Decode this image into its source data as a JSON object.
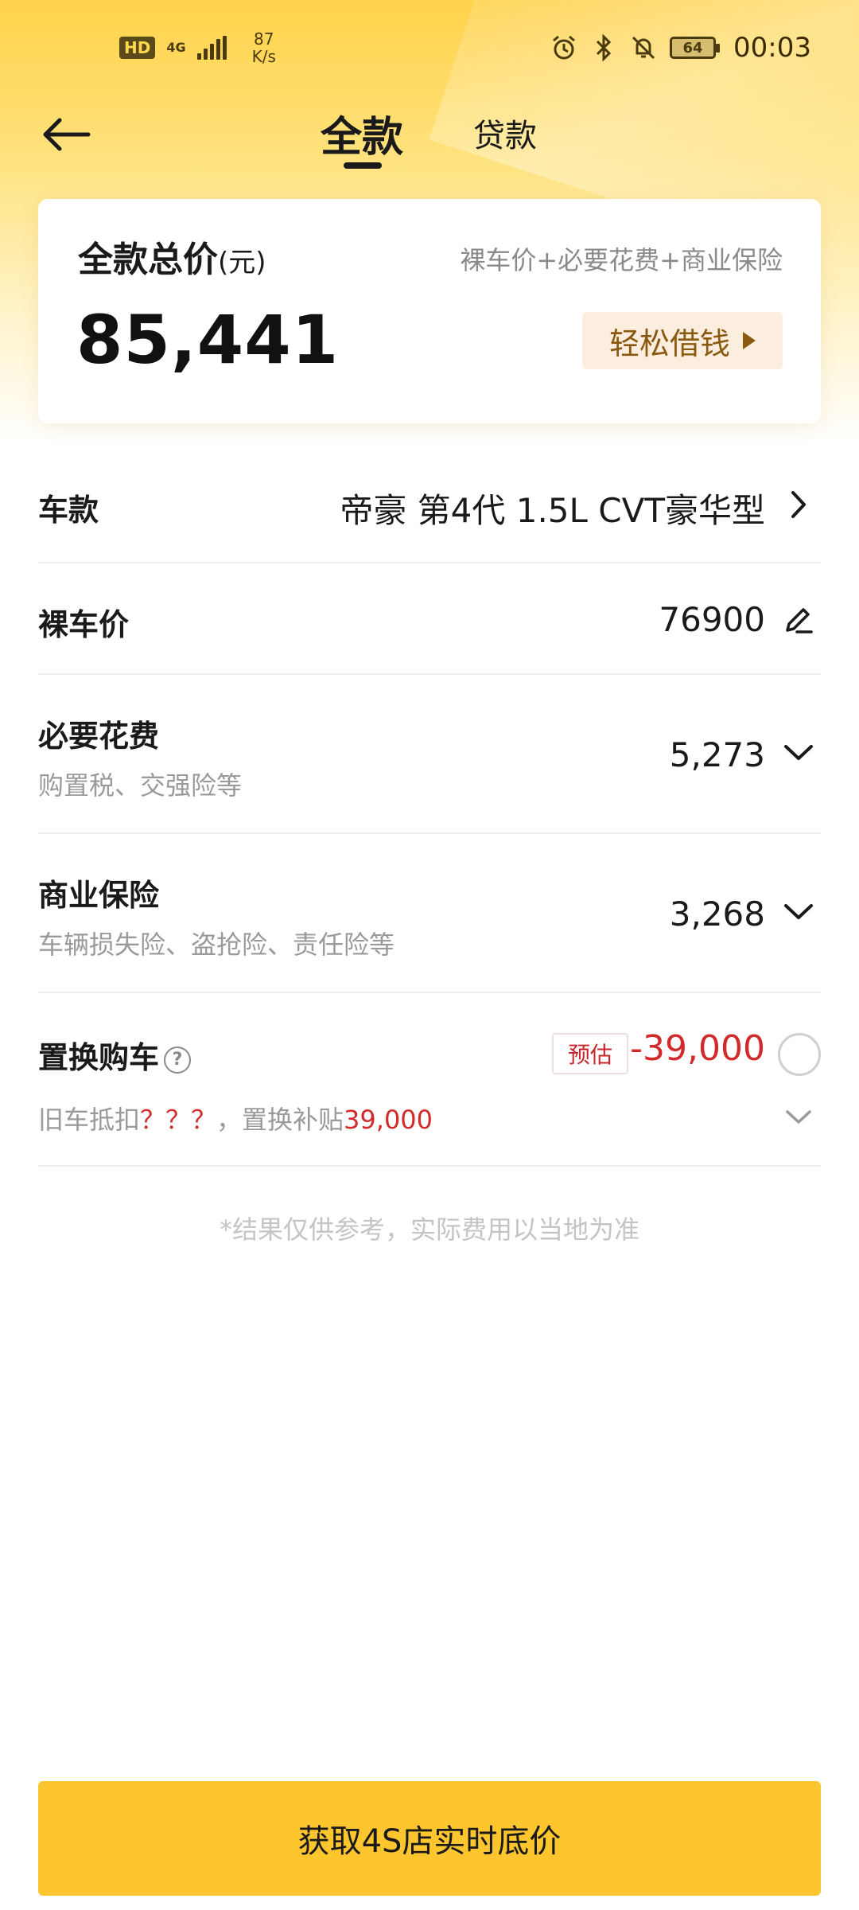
{
  "status_bar": {
    "hd": "HD",
    "network": "4G",
    "speed_value": "87",
    "speed_unit": "K/s",
    "battery": "64",
    "time": "00:03",
    "icons": [
      "alarm-icon",
      "bluetooth-icon",
      "mute-bell-icon"
    ]
  },
  "header": {
    "back_icon": "arrow-left-icon",
    "tabs": [
      {
        "label": "全款",
        "active": true
      },
      {
        "label": "贷款",
        "active": false
      }
    ]
  },
  "summary": {
    "title": "全款总价",
    "unit": "(元)",
    "formula": "裸车价+必要花费+商业保险",
    "total": "85,441",
    "loan_button": "轻松借钱"
  },
  "rows": {
    "model": {
      "label": "车款",
      "value": "帝豪 第4代 1.5L CVT豪华型"
    },
    "bare_price": {
      "label": "裸车价",
      "value": "76900"
    },
    "required_fees": {
      "label": "必要花费",
      "sub": "购置税、交强险等",
      "value": "5,273"
    },
    "commercial_insurance": {
      "label": "商业保险",
      "sub": "车辆损失险、盗抢险、责任险等",
      "value": "3,268"
    },
    "trade_in": {
      "label": "置换购车",
      "badge": "预估",
      "value": "-39,000",
      "sub_prefix": "旧车抵扣",
      "sub_unknown": "？？？",
      "sub_middle": "，置换补贴",
      "sub_amount": "39,000"
    }
  },
  "disclaimer": "*结果仅供参考，实际费用以当地为准",
  "cta": "获取4S店实时底价",
  "colors": {
    "accent_yellow": "#fdc52e",
    "price_red": "#d22a2a",
    "loan_brown": "#8a5a10"
  }
}
